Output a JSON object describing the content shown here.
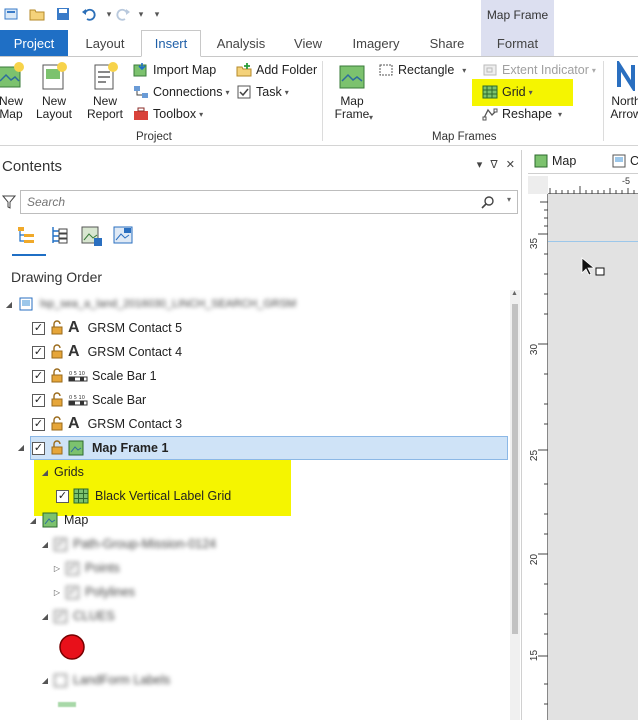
{
  "qat": {
    "more_label": "▾"
  },
  "context_group": "Map Frame",
  "tabs": [
    {
      "id": "project",
      "label": "Project"
    },
    {
      "id": "layout",
      "label": "Layout"
    },
    {
      "id": "insert",
      "label": "Insert"
    },
    {
      "id": "analysis",
      "label": "Analysis"
    },
    {
      "id": "view",
      "label": "View"
    },
    {
      "id": "imagery",
      "label": "Imagery"
    },
    {
      "id": "share",
      "label": "Share"
    },
    {
      "id": "format",
      "label": "Format"
    }
  ],
  "ribbon": {
    "project": {
      "new_map": "New\nMap",
      "new_layout": "New\nLayout",
      "new_report": "New\nReport",
      "import_map": "Import Map",
      "connections": "Connections",
      "toolbox": "Toolbox",
      "add_folder": "Add Folder",
      "task": "Task",
      "label": "Project"
    },
    "map_frames": {
      "map_frame": "Map\nFrame",
      "rectangle": "Rectangle",
      "extent_indicator": "Extent Indicator",
      "grid": "Grid",
      "reshape": "Reshape",
      "label": "Map Frames"
    },
    "north_arrow": "North\nArrow"
  },
  "contents": {
    "title": "Contents",
    "pin": "ᐁ",
    "autohide": "ꟼ",
    "close": "✕",
    "search_placeholder": "Search",
    "drawing_order": "Drawing Order",
    "layout_name": "lsp_sea_a_land_2016030_LINCH_SEARCH_GRSM",
    "items": [
      {
        "label": "GRSM Contact 5",
        "type": "text"
      },
      {
        "label": "GRSM Contact 4",
        "type": "text"
      },
      {
        "label": "Scale Bar 1",
        "type": "scalebar"
      },
      {
        "label": "Scale Bar",
        "type": "scalebar"
      },
      {
        "label": "GRSM Contact 3",
        "type": "text"
      },
      {
        "label": "Map Frame 1",
        "type": "mapframe"
      }
    ],
    "grids_label": "Grids",
    "grid_item": "Black Vertical Label Grid",
    "map_label": "Map",
    "blurred": {
      "group1": "Path-Group-Mission-0124",
      "points": "Points",
      "polylines": "Polylines",
      "group2": "CLUES",
      "group3": "LandForm Labels"
    }
  },
  "map_view": {
    "tab_label": "Map",
    "tab2_label": "C",
    "ruler_top_value": "-5",
    "ruler_left_values": [
      "35",
      "30",
      "25",
      "20",
      "15"
    ]
  },
  "colors": {
    "accent": "#1f6fc5",
    "highlight": "#f5f500",
    "selection": "#cfe3f7",
    "context_tab": "#dcdff0"
  }
}
